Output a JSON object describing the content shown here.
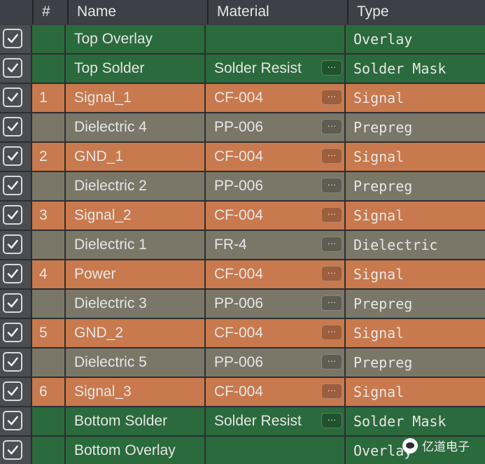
{
  "columns": {
    "number": "#",
    "name": "Name",
    "material": "Material",
    "type": "Type"
  },
  "colors": {
    "overlay_green": "#2b6a3c",
    "signal_orange": "#c8794d",
    "dielectric_gray": "#7a7768",
    "text_light": "#e6e6e6"
  },
  "layers": [
    {
      "checked": true,
      "number": "",
      "name": "Top Overlay",
      "material": "",
      "type": "Overlay",
      "kind": "overlay",
      "has_ellipsis": false
    },
    {
      "checked": true,
      "number": "",
      "name": "Top Solder",
      "material": "Solder Resist",
      "type": "Solder Mask",
      "kind": "overlay",
      "has_ellipsis": true
    },
    {
      "checked": true,
      "number": "1",
      "name": "Signal_1",
      "material": "CF-004",
      "type": "Signal",
      "kind": "signal",
      "has_ellipsis": true
    },
    {
      "checked": true,
      "number": "",
      "name": "Dielectric 4",
      "material": "PP-006",
      "type": "Prepreg",
      "kind": "dielectric",
      "has_ellipsis": true
    },
    {
      "checked": true,
      "number": "2",
      "name": "GND_1",
      "material": "CF-004",
      "type": "Signal",
      "kind": "signal",
      "has_ellipsis": true
    },
    {
      "checked": true,
      "number": "",
      "name": "Dielectric 2",
      "material": "PP-006",
      "type": "Prepreg",
      "kind": "dielectric",
      "has_ellipsis": true
    },
    {
      "checked": true,
      "number": "3",
      "name": "Signal_2",
      "material": "CF-004",
      "type": "Signal",
      "kind": "signal",
      "has_ellipsis": true
    },
    {
      "checked": true,
      "number": "",
      "name": "Dielectric 1",
      "material": "FR-4",
      "type": "Dielectric",
      "kind": "dielectric",
      "has_ellipsis": true
    },
    {
      "checked": true,
      "number": "4",
      "name": "Power",
      "material": "CF-004",
      "type": "Signal",
      "kind": "signal",
      "has_ellipsis": true
    },
    {
      "checked": true,
      "number": "",
      "name": "Dielectric 3",
      "material": "PP-006",
      "type": "Prepreg",
      "kind": "dielectric",
      "has_ellipsis": true
    },
    {
      "checked": true,
      "number": "5",
      "name": "GND_2",
      "material": "CF-004",
      "type": "Signal",
      "kind": "signal",
      "has_ellipsis": true
    },
    {
      "checked": true,
      "number": "",
      "name": "Dielectric 5",
      "material": "PP-006",
      "type": "Prepreg",
      "kind": "dielectric",
      "has_ellipsis": true
    },
    {
      "checked": true,
      "number": "6",
      "name": "Signal_3",
      "material": "CF-004",
      "type": "Signal",
      "kind": "signal",
      "has_ellipsis": true
    },
    {
      "checked": true,
      "number": "",
      "name": "Bottom Solder",
      "material": "Solder Resist",
      "type": "Solder Mask",
      "kind": "overlay",
      "has_ellipsis": true
    },
    {
      "checked": true,
      "number": "",
      "name": "Bottom Overlay",
      "material": "",
      "type": "Overlay",
      "kind": "overlay",
      "has_ellipsis": false
    }
  ],
  "ellipsis_label": "···",
  "watermark": {
    "text": "亿道电子",
    "icon": "wechat-icon"
  }
}
